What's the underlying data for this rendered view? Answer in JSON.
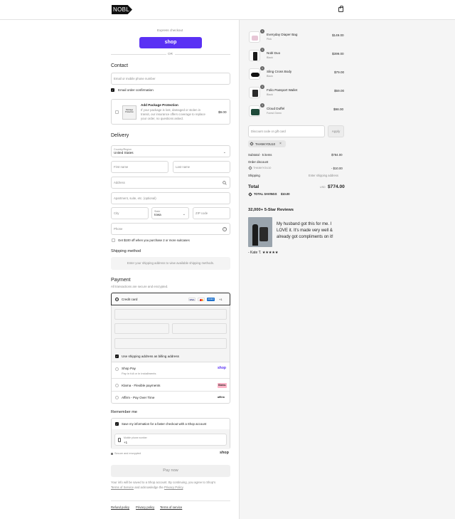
{
  "brand": {
    "logo_text": "NOBL"
  },
  "express": {
    "label": "Express checkout",
    "shop_button": "shop",
    "or_label": "OR"
  },
  "contact": {
    "heading": "Contact",
    "email_placeholder": "Email or mobile phone number",
    "email_news_label": "Email order confirmation",
    "protection": {
      "title": "Add Package Protection",
      "desc_line1": "If your package is lost, damaged or stolen in",
      "desc_line2": "transit, our insurance offers coverage to replace",
      "desc_line3": "your order, no questions asked.",
      "price": "$9.00",
      "thumb_text": "Package Protection"
    }
  },
  "delivery": {
    "heading": "Delivery",
    "country_label": "Country/Region",
    "country_value": "United States",
    "first_name": "First name",
    "last_name": "Last name",
    "address": "Address",
    "apartment": "Apartment, suite, etc. (optional)",
    "city": "City",
    "state_label": "State",
    "state_value": "Iowa",
    "zip": "ZIP code",
    "phone": "Phone",
    "promo_label": "Get $100 off when you purchase 2 or more suitcases"
  },
  "shipping_method": {
    "heading": "Shipping method",
    "placeholder": "Enter your shipping address to view available shipping methods."
  },
  "payment": {
    "heading": "Payment",
    "subtext": "All transactions are secure and encrypted.",
    "credit_card": "Credit card",
    "card_brands": [
      "VISA",
      "MC",
      "AMEX",
      "+1"
    ],
    "billing_same": "Use shipping address as billing address",
    "shop_pay": "Shop Pay",
    "shop_pay_sub": "Pay in full or in installments",
    "shop_pay_logo": "shop",
    "klarna": "Klarna - Flexible payments",
    "klarna_logo": "Klarna.",
    "affirm": "Affirm - Pay Over Time",
    "affirm_logo": "affirm"
  },
  "remember": {
    "heading": "Remember me",
    "save_label": "Save my information for a faster checkout with a Shop account",
    "mobile_label": "Mobile phone number",
    "mobile_value": "+1",
    "secure": "Secure and encrypted",
    "shop_logo": "shop"
  },
  "pay_now": "Pay now",
  "legal": {
    "line1": "Your info will be saved to a Shop account. By continuing, you agree to Shop's",
    "tos": "Terms of Service",
    "and_ack": " and acknowledge the ",
    "privacy": "Privacy Policy",
    "period": "."
  },
  "footer_links": [
    "Refund policy",
    "Privacy policy",
    "Terms of service"
  ],
  "items": [
    {
      "qty": "1",
      "name": "Everyday Diaper Bag",
      "variant": "Pink",
      "price": "$149.00",
      "color": "#e7c6d6"
    },
    {
      "qty": "1",
      "name": "Nobl Duo",
      "variant": "Black",
      "price": "$399.00",
      "color": "#1b1b1b"
    },
    {
      "qty": "1",
      "name": "Sling Cross Body",
      "variant": "Black",
      "price": "$79.00",
      "color": "#111111"
    },
    {
      "qty": "1",
      "name": "Folio Passport Wallet",
      "variant": "Black",
      "price": "$59.00",
      "color": "#2a2a2a"
    },
    {
      "qty": "1",
      "name": "Cloud Duffel",
      "variant": "Forest Green",
      "price": "$98.00",
      "color": "#1f4a3a"
    }
  ],
  "discount": {
    "placeholder": "Discount code or gift card",
    "apply": "Apply",
    "tag": "THANKYOU10"
  },
  "summary": {
    "subtotal_label": "Subtotal · 5 items",
    "subtotal": "$784.00",
    "order_discount": "Order discount",
    "code": "THANKYOU10",
    "discount_value": "- $10.00",
    "shipping_label": "Shipping",
    "shipping_value": "Enter shipping address",
    "total_label": "Total",
    "currency": "USD",
    "total": "$774.00",
    "savings_label": "TOTAL SAVINGS",
    "savings": "$10.00"
  },
  "reviews": {
    "heading": "32,000+ 5-Star Reviews",
    "quote_line1": "My husband got this for me. I",
    "quote_line2": "LOVE it. It's made very well &",
    "quote_line3": "already got compliments on it!",
    "author": "- Kate T. ★★★★★"
  }
}
